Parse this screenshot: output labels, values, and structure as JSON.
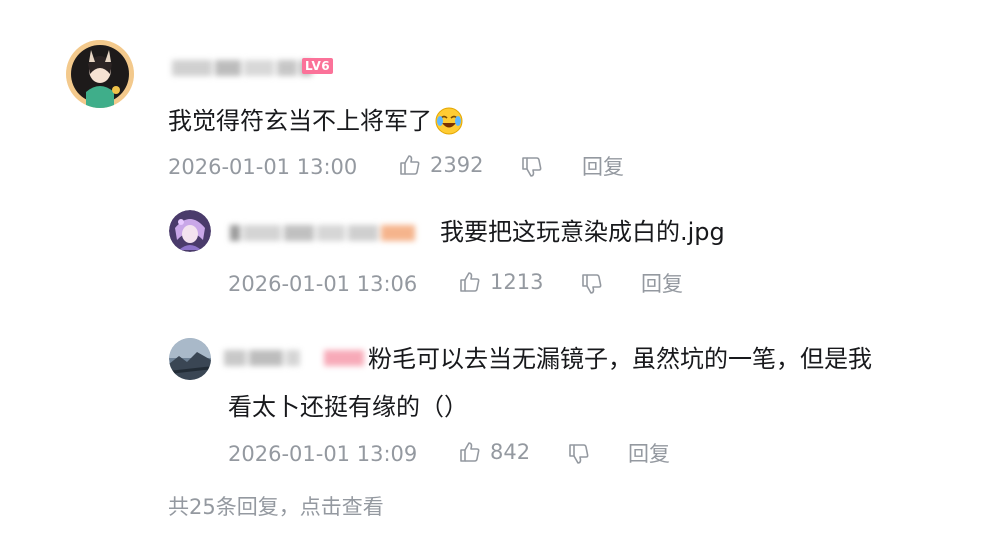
{
  "comment": {
    "level_badge": "LV6",
    "content": "我觉得符玄当不上将军了",
    "emoji": "laughing-crying-emoji",
    "time": "2026-01-01 13:00",
    "likes": "2392",
    "reply_label": "回复"
  },
  "replies": [
    {
      "content": "我要把这玩意染成白的.jpg",
      "time": "2026-01-01 13:06",
      "likes": "1213",
      "reply_label": "回复"
    },
    {
      "content_line1": "粉毛可以去当无漏镜子，虽然坑的一笔，但是我",
      "content_line2": "看太卜还挺有缘的（）",
      "time": "2026-01-01 13:09",
      "likes": "842",
      "reply_label": "回复"
    }
  ],
  "footer": {
    "more_replies": "共25条回复，点击查看"
  },
  "colors": {
    "text": "#18191c",
    "meta": "#9499a0",
    "level_badge": "#fb7299"
  }
}
